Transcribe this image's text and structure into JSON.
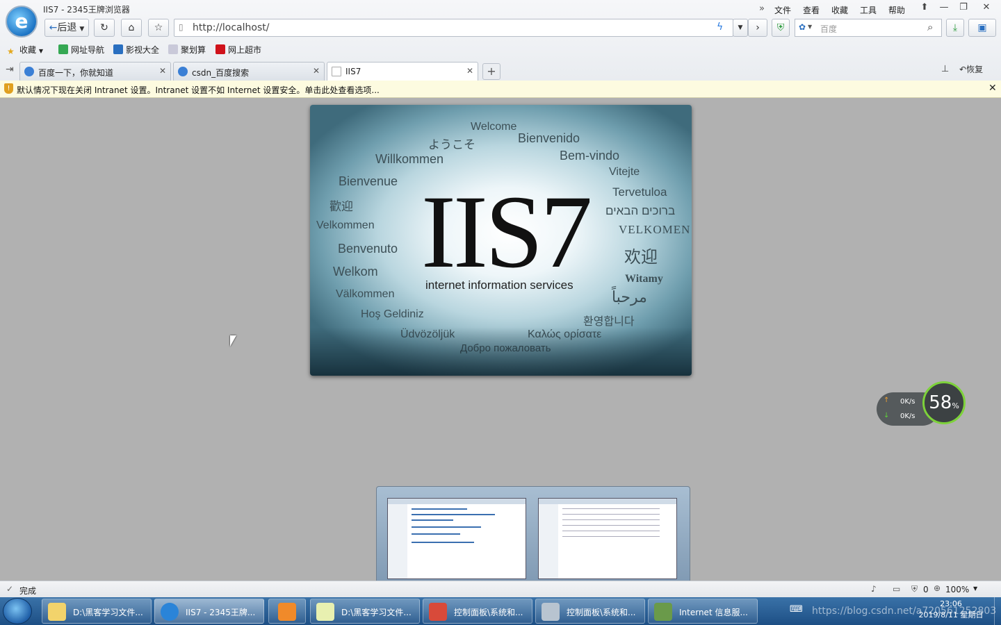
{
  "window": {
    "title": "IIS7 - 2345王牌浏览器"
  },
  "menu": [
    "文件",
    "查看",
    "收藏",
    "工具",
    "帮助"
  ],
  "nav": {
    "back_label": "后退",
    "url": "http://localhost/",
    "search_placeholder": "百度"
  },
  "bookmarks": [
    "收藏",
    "网址导航",
    "影视大全",
    "聚划算",
    "网上超市"
  ],
  "tabs": [
    {
      "label": "百度一下，你就知道"
    },
    {
      "label": "csdn_百度搜索"
    },
    {
      "label": "IIS7"
    }
  ],
  "tab_right": {
    "restore_label": "恢复"
  },
  "infobar": {
    "text": "默认情况下现在关闭 Intranet 设置。Intranet 设置不如 Internet 设置安全。单击此处查看选项..."
  },
  "iis": {
    "title": "IIS7",
    "subtitle": "internet information services",
    "words": [
      "Welcome",
      "ようこそ",
      "Bienvenido",
      "Willkommen",
      "Bem-vindo",
      "Vitejte",
      "Bienvenue",
      "Tervetuloa",
      "歡迎",
      "ברוכים הבאים",
      "Velkommen",
      "VELKOMEN",
      "Benvenuto",
      "欢迎",
      "Welkom",
      "Witamy",
      "Välkommen",
      "مرحباً",
      "Hoş Geldiniz",
      "환영합니다",
      "Üdvözöljük",
      "Καλώς ορίσατε",
      "Добро пожаловать"
    ]
  },
  "speed": {
    "up": "0K/s",
    "down": "0K/s",
    "percent": "58",
    "percent_unit": "%"
  },
  "status": {
    "text": "完成",
    "shield_count": "0",
    "zoom": "100%"
  },
  "taskbar": [
    {
      "label": "D:\\黑客学习文件..."
    },
    {
      "label": "IIS7 - 2345王牌..."
    },
    {
      "label": ""
    },
    {
      "label": "D:\\黑客学习文件..."
    },
    {
      "label": "控制面板\\系统和..."
    },
    {
      "label": "控制面板\\系统和..."
    },
    {
      "label": "Internet 信息服..."
    }
  ],
  "clock": {
    "time": "23:06",
    "date": "2019/8/11 星期日"
  },
  "watermark": "https://blog.csdn.net/a720561252803",
  "colors": {
    "accent": "#1d74c4",
    "taskbar": "#1d4f85",
    "infobar": "#fdfbe0"
  }
}
